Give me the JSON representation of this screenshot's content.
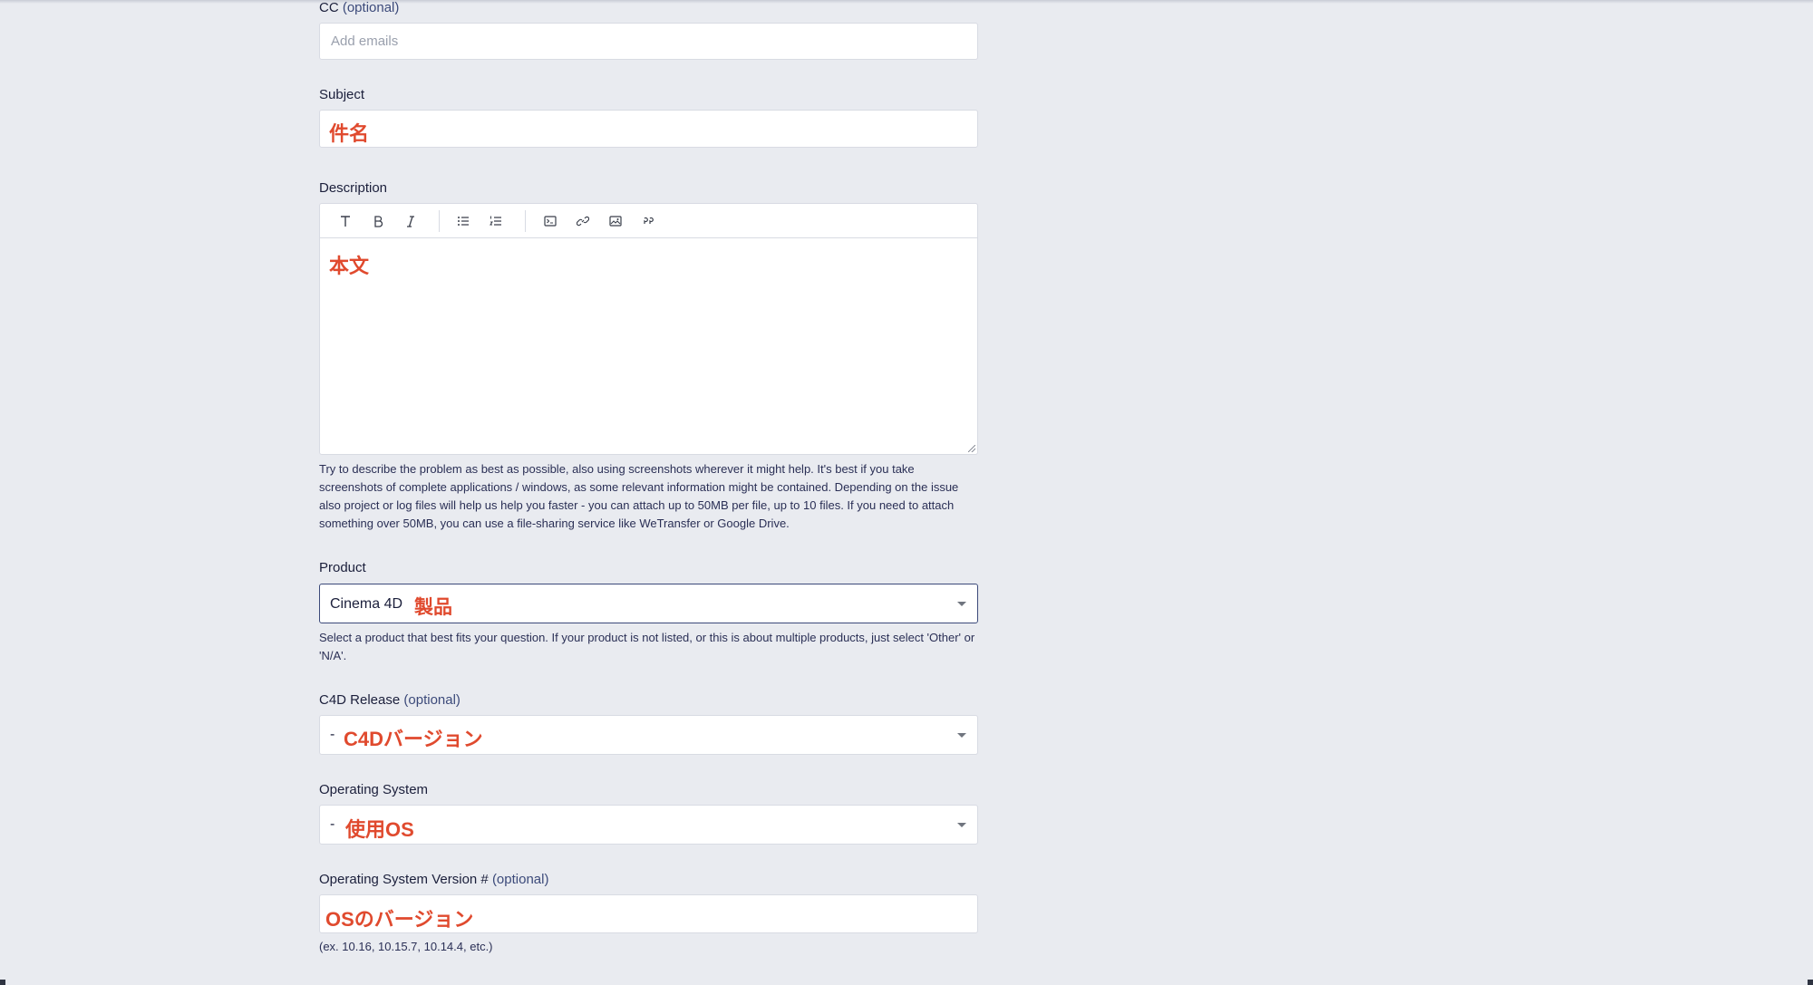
{
  "cc": {
    "label": "CC",
    "optional": "(optional)",
    "placeholder": "Add emails"
  },
  "subject": {
    "label": "Subject",
    "value": "件名"
  },
  "description": {
    "label": "Description",
    "toolbar": [
      "text-icon",
      "bold-icon",
      "italic-icon",
      "bulleted-list-icon",
      "numbered-list-icon",
      "code-block-icon",
      "link-icon",
      "image-icon",
      "quote-icon"
    ],
    "value": "本文",
    "help": "Try to describe the problem as best as possible, also using screenshots wherever it might help. It's best if you take screenshots of complete applications / windows, as some relevant information might be contained. Depending on the issue also project or log files will help us help you faster - you can attach up to 50MB per file, up to 10 files. If you need to attach something over 50MB, you can use a file-sharing service like WeTransfer or Google Drive."
  },
  "product": {
    "label": "Product",
    "selected": "Cinema 4D",
    "annotation": "製品",
    "help": "Select a product that best fits your question. If your product is not listed, or this is about multiple products, just select 'Other' or 'N/A'."
  },
  "c4d_release": {
    "label": "C4D Release",
    "optional": "(optional)",
    "selected": "-",
    "annotation": "C4Dバージョン"
  },
  "os": {
    "label": "Operating System",
    "selected": "-",
    "annotation": "使用OS"
  },
  "os_version": {
    "label": "Operating System Version #",
    "optional": "(optional)",
    "value": "OSのバージョン",
    "help": "(ex. 10.16, 10.15.7, 10.14.4, etc.)"
  },
  "colors": {
    "background": "#e9ebf0",
    "annotation_red": "#e04a2e",
    "focus_border": "#3c4a7a"
  }
}
